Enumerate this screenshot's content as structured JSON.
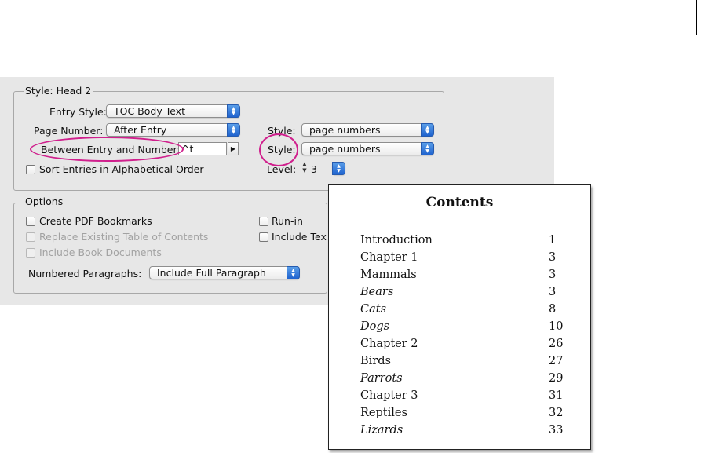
{
  "dialog": {
    "style_group": {
      "title": "Style: Head 2",
      "entry_style": {
        "label": "Entry Style:",
        "value": "TOC Body Text"
      },
      "page_number": {
        "label": "Page Number:",
        "value": "After Entry"
      },
      "between": {
        "label": "Between Entry and Number:",
        "value": "^t"
      },
      "style_top": {
        "label": "Style:",
        "value": "page numbers"
      },
      "style_bottom": {
        "label": "Style:",
        "value": "page numbers"
      },
      "sort": {
        "label": "Sort Entries in Alphabetical Order",
        "checked": false
      },
      "level": {
        "label": "Level:",
        "value": "3"
      }
    },
    "options_group": {
      "title": "Options",
      "create_pdf": {
        "label": "Create PDF Bookmarks",
        "checked": false,
        "enabled": true
      },
      "replace_toc": {
        "label": "Replace Existing Table of Contents",
        "checked": false,
        "enabled": false
      },
      "include_book": {
        "label": "Include Book Documents",
        "checked": false,
        "enabled": false
      },
      "run_in": {
        "label": "Run-in",
        "checked": false
      },
      "include_text": {
        "label": "Include Tex",
        "checked": false
      },
      "numbered": {
        "label": "Numbered Paragraphs:",
        "value": "Include Full Paragraph"
      }
    },
    "highlight_color": "#d0208d"
  },
  "contents": {
    "title": "Contents",
    "entries": [
      {
        "text": "Introduction",
        "page": "1",
        "italic": false
      },
      {
        "text": "Chapter 1",
        "page": "3",
        "italic": false
      },
      {
        "text": "Mammals",
        "page": "3",
        "italic": false
      },
      {
        "text": "Bears",
        "page": "3",
        "italic": true
      },
      {
        "text": "Cats",
        "page": "8",
        "italic": true
      },
      {
        "text": "Dogs",
        "page": "10",
        "italic": true
      },
      {
        "text": "Chapter 2",
        "page": "26",
        "italic": false
      },
      {
        "text": "Birds",
        "page": "27",
        "italic": false
      },
      {
        "text": "Parrots",
        "page": "29",
        "italic": true
      },
      {
        "text": "Chapter 3",
        "page": "31",
        "italic": false
      },
      {
        "text": "Reptiles",
        "page": "32",
        "italic": false
      },
      {
        "text": "Lizards",
        "page": "33",
        "italic": true
      }
    ]
  }
}
